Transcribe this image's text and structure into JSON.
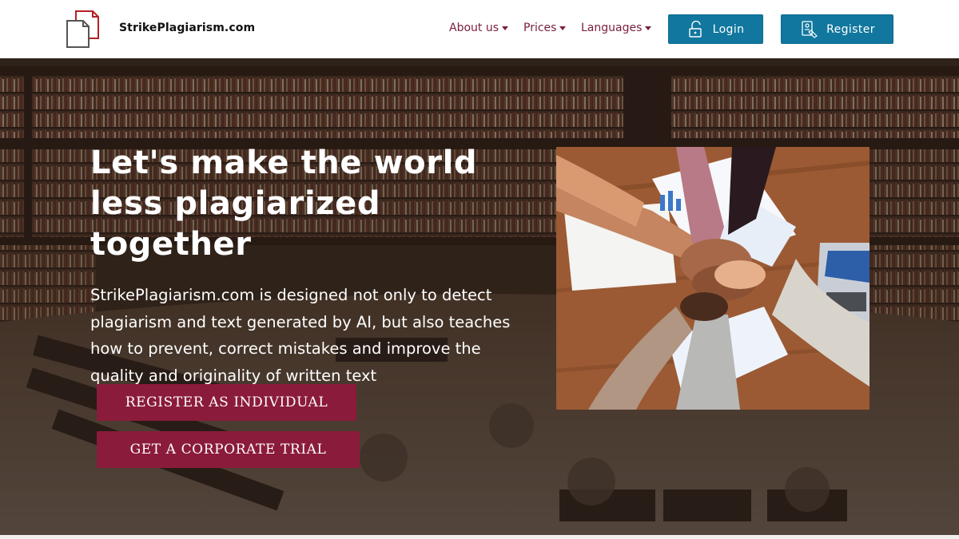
{
  "header": {
    "brand": "StrikePlagiarism.com",
    "nav": {
      "about": "About us",
      "prices": "Prices",
      "languages": "Languages"
    },
    "login_label": "Login",
    "register_label": "Register"
  },
  "hero": {
    "headline": "Let's make the world less plagiarized together",
    "description": "StrikePlagiarism.com is designed not only to detect plagiarism and text generated by AI, but also teaches how to prevent, correct mistakes and improve the quality and originality of written text",
    "register_individual_label": "REGISTER AS INDIVIDUAL",
    "corporate_trial_label": "GET A CORPORATE TRIAL"
  },
  "colors": {
    "accent_blue": "#11779f",
    "accent_crimson": "#8b1b3a",
    "nav_text": "#7a1f3a"
  },
  "icons": [
    "document-logo-icon",
    "caret-down-icon",
    "unlock-icon",
    "register-card-icon"
  ]
}
